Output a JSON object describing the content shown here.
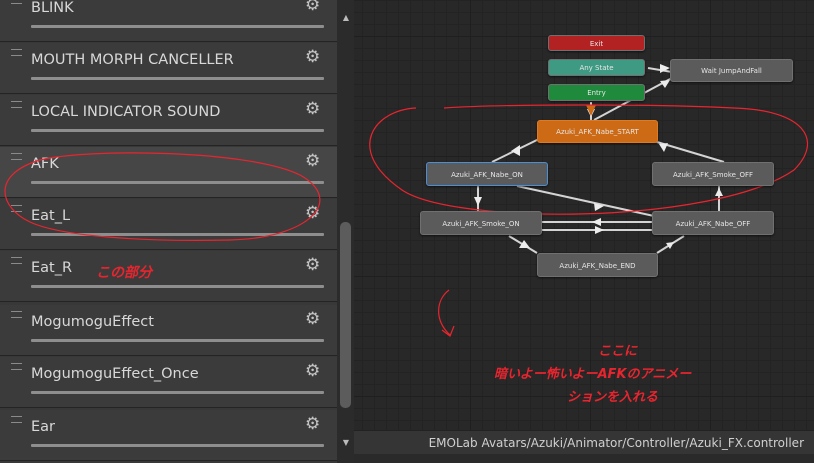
{
  "layers": [
    {
      "name": "BLINK"
    },
    {
      "name": "MOUTH MORPH CANCELLER"
    },
    {
      "name": "LOCAL INDICATOR SOUND"
    },
    {
      "name": "AFK",
      "selected": true
    },
    {
      "name": "Eat_L"
    },
    {
      "name": "Eat_R"
    },
    {
      "name": "MogumoguEffect"
    },
    {
      "name": "MogumoguEffect_Once"
    },
    {
      "name": "Ear"
    }
  ],
  "graph": {
    "nodes": {
      "exit": {
        "label": "Exit",
        "color": "#b32222"
      },
      "any_state": {
        "label": "Any State",
        "color": "#3f9a83"
      },
      "entry": {
        "label": "Entry",
        "color": "#1f8a3c"
      },
      "wait": {
        "label": "Wait JumpAndFall",
        "color": "#5b5b5b"
      },
      "start": {
        "label": "Azuki_AFK_Nabe_START",
        "color": "#cc6a15"
      },
      "on": {
        "label": "Azuki_AFK_Nabe_ON",
        "color": "#5b5b5b"
      },
      "smoke_off": {
        "label": "Azuki_AFK_Smoke_OFF",
        "color": "#5b5b5b"
      },
      "smoke_on": {
        "label": "Azuki_AFK_Smoke_ON",
        "color": "#5b5b5b"
      },
      "off": {
        "label": "Azuki_AFK_Nabe_OFF",
        "color": "#5b5b5b"
      },
      "end": {
        "label": "Azuki_AFK_Nabe_END",
        "color": "#5b5b5b"
      }
    },
    "path": "EMOLab Avatars/Azuki/Animator/Controller/Azuki_FX.controller"
  },
  "annotations": {
    "this_part": "この部分",
    "here_line1": "ここに",
    "here_line2": "暗いよー怖いよーAFKのアニメー",
    "here_line3": "ションを入れる",
    "color": "#e8252f"
  }
}
